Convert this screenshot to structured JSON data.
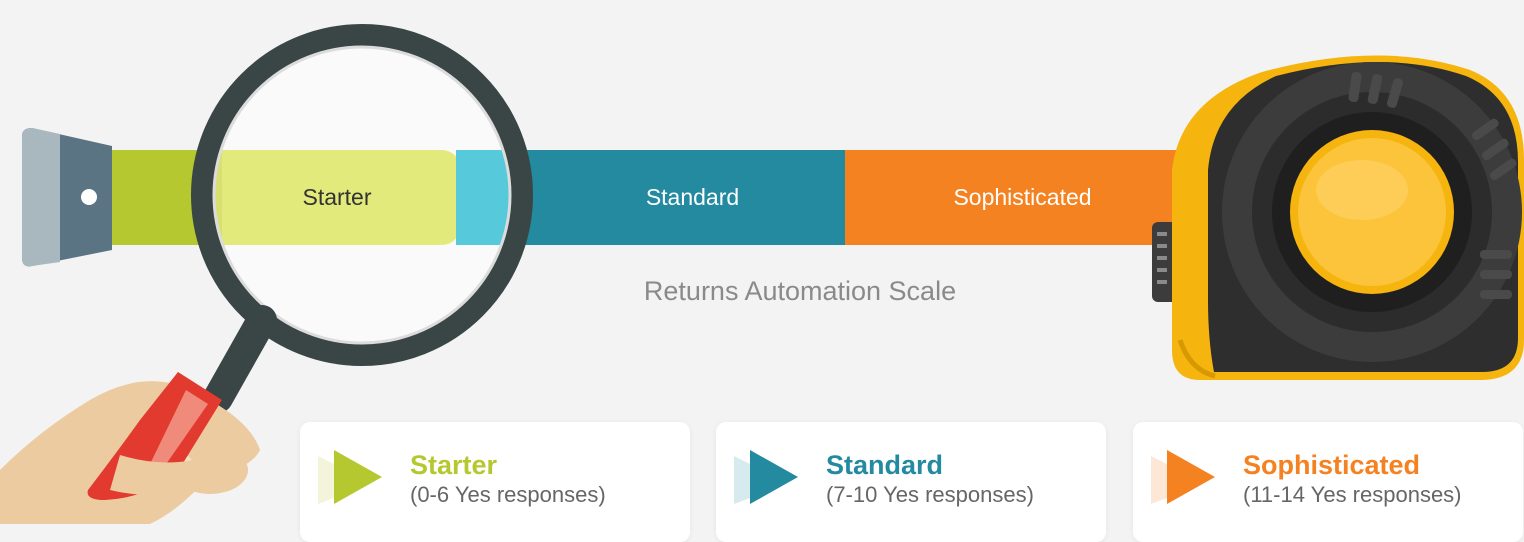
{
  "colors": {
    "background": "#f3f3f3",
    "starter": "#b5c830",
    "starter_light": "#e3ea7c",
    "standard": "#238aa0",
    "standard_light": "#56c9da",
    "sophisticated": "#f58220",
    "tape_case_yellow": "#f6b40f",
    "tape_case_dark": "#3c3c3c",
    "glove_red": "#e23a2e",
    "skin": "#eccba0"
  },
  "scale": {
    "bands": [
      {
        "label": "Starter"
      },
      {
        "label": "Standard"
      },
      {
        "label": "Sophisticated"
      }
    ],
    "caption": "Returns Automation Scale"
  },
  "legend": [
    {
      "title": "Starter",
      "range": "(0-6 Yes responses)",
      "color": "#b5c830"
    },
    {
      "title": "Standard",
      "range": "(7-10 Yes responses)",
      "color": "#238aa0"
    },
    {
      "title": "Sophisticated",
      "range": "(11-14 Yes responses)",
      "color": "#f58220"
    }
  ],
  "icons": [
    "tape-hook-icon",
    "magnifying-glass-icon",
    "hand-icon",
    "tape-measure-case-icon",
    "play-arrow-icon"
  ]
}
